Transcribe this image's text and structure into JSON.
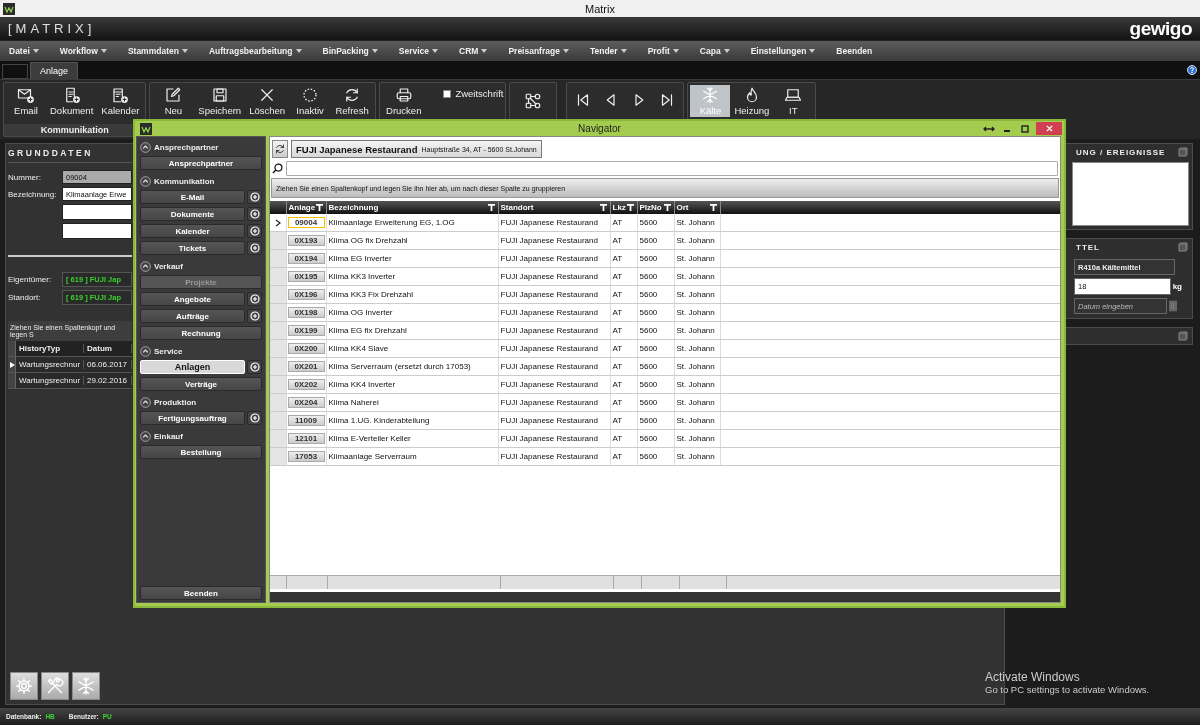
{
  "window": {
    "title": "Matrix"
  },
  "header": {
    "app_name": "[MATRIX]",
    "logo": "gewigo"
  },
  "menu": [
    {
      "label": "Datei",
      "kind": "dropdown"
    },
    {
      "label": "Workflow",
      "kind": "dropdown"
    },
    {
      "label": "Stammdaten",
      "kind": "dropdown"
    },
    {
      "label": "Auftragsbearbeitung",
      "kind": "dropdown"
    },
    {
      "label": "BinPacking",
      "kind": "dropdown"
    },
    {
      "label": "Service",
      "kind": "dropdown"
    },
    {
      "label": "CRM",
      "kind": "dropdown"
    },
    {
      "label": "Preisanfrage",
      "kind": "dropdown"
    },
    {
      "label": "Tender",
      "kind": "dropdown"
    },
    {
      "label": "Profit",
      "kind": "dropdown"
    },
    {
      "label": "Capa",
      "kind": "dropdown"
    },
    {
      "label": "Einstellungen",
      "kind": "dropdown"
    },
    {
      "label": "Beenden",
      "kind": "action"
    }
  ],
  "tabs": [
    {
      "label": "Anlage",
      "selected": true
    }
  ],
  "ribbon": {
    "groups": [
      {
        "label": "Kommunikation",
        "buttons": [
          {
            "kind": "email",
            "label": "Email"
          },
          {
            "kind": "document",
            "label": "Dokument"
          },
          {
            "kind": "calendar",
            "label": "Kalender"
          }
        ]
      },
      {
        "buttons": [
          {
            "kind": "new",
            "label": "Neu"
          },
          {
            "kind": "save",
            "label": "Speichern"
          },
          {
            "kind": "delete",
            "label": "Löschen"
          },
          {
            "kind": "inactive",
            "label": "Inaktiv"
          },
          {
            "kind": "refresh",
            "label": "Refresh"
          }
        ]
      },
      {
        "buttons": [
          {
            "kind": "print",
            "label": "Drucken"
          },
          {
            "kind": "checkbox",
            "label": "Zweitschrift",
            "checked": false
          }
        ]
      },
      {
        "buttons": [
          {
            "kind": "workflow"
          }
        ]
      },
      {
        "buttons": [
          {
            "kind": "first"
          },
          {
            "kind": "prev"
          },
          {
            "kind": "next"
          },
          {
            "kind": "last"
          }
        ]
      },
      {
        "buttons": [
          {
            "kind": "cold",
            "label": "Kälte",
            "selected": true
          },
          {
            "kind": "heat",
            "label": "Heizung",
            "selected": false
          },
          {
            "kind": "it",
            "label": "IT",
            "selected": false
          }
        ]
      }
    ]
  },
  "grunddaten": {
    "title": "GRUNDDATEN",
    "fields": [
      {
        "label": "Nummer:",
        "value": "09004"
      },
      {
        "label": "Bezeichnung:",
        "value": "Klimaanlage Erwe"
      }
    ],
    "links": [
      {
        "label": "Eigentümer:",
        "value": "[ 619 ] FUJI Jap"
      },
      {
        "label": "Standort:",
        "value": "[ 619 ] FUJI Jap"
      }
    ]
  },
  "history": {
    "group_hint": "Ziehen Sie einen Spaltenkopf und legen S",
    "columns": [
      "HistoryTyp",
      "Datum"
    ],
    "rows": [
      {
        "cells": [
          "Wartungsrechnur",
          "06.06.2017"
        ],
        "selected": true
      },
      {
        "cells": [
          "Wartungsrechnur",
          "29.02.2016"
        ],
        "selected": false
      }
    ]
  },
  "bottom_buttons": [
    {
      "kind": "gear"
    },
    {
      "kind": "tools"
    },
    {
      "kind": "cold"
    }
  ],
  "right_panels": [
    {
      "kind": "notes",
      "title": "UNG / EREIGNISSE"
    },
    {
      "kind": "refrigerant",
      "title": "TTEL",
      "refrigerant": "R410a Kältemittel",
      "amount": "18",
      "unit": "kg",
      "date_placeholder": "Datum eingeben"
    },
    {
      "kind": "empty"
    }
  ],
  "navigator": {
    "title": "Navigator",
    "sections": [
      {
        "title": "Ansprechpartner",
        "expanded": true,
        "items": [
          {
            "label": "Ansprechpartner",
            "add": false,
            "disabled": false,
            "selected": false
          }
        ]
      },
      {
        "title": "Kommunikation",
        "expanded": true,
        "items": [
          {
            "label": "E-Mail",
            "add": true,
            "disabled": false,
            "selected": false
          },
          {
            "label": "Dokumente",
            "add": true,
            "disabled": false,
            "selected": false
          },
          {
            "label": "Kalender",
            "add": true,
            "disabled": false,
            "selected": false
          },
          {
            "label": "Tickets",
            "add": true,
            "disabled": false,
            "selected": false
          }
        ]
      },
      {
        "title": "Verkauf",
        "expanded": true,
        "items": [
          {
            "label": "Projekte",
            "add": false,
            "disabled": true,
            "selected": false
          },
          {
            "label": "Angebote",
            "add": true,
            "disabled": false,
            "selected": false
          },
          {
            "label": "Aufträge",
            "add": true,
            "disabled": false,
            "selected": false
          },
          {
            "label": "Rechnung",
            "add": false,
            "disabled": false,
            "selected": false
          }
        ]
      },
      {
        "title": "Service",
        "expanded": true,
        "items": [
          {
            "label": "Anlagen",
            "add": true,
            "disabled": false,
            "selected": true
          },
          {
            "label": "Verträge",
            "add": false,
            "disabled": false,
            "selected": false
          }
        ]
      },
      {
        "title": "Produktion",
        "expanded": true,
        "items": [
          {
            "label": "Fertigungsauftrag",
            "add": true,
            "disabled": false,
            "selected": false
          }
        ]
      },
      {
        "title": "Einkauf",
        "expanded": true,
        "items": [
          {
            "label": "Bestellung",
            "add": false,
            "disabled": false,
            "selected": false
          }
        ]
      }
    ],
    "exit": "Beenden",
    "customer": {
      "name": "FUJI Japanese Restaurand",
      "address": "Hauptstraße 34, AT - 5600 St.Johann"
    },
    "group_hint": "Ziehen Sie einen Spaltenkopf und legen Sie ihn hier ab, um nach dieser Spalte zu gruppieren",
    "columns": [
      "Anlage",
      "Bezeichnung",
      "Standort",
      "Lkz",
      "PlzNo",
      "Ort"
    ],
    "rows": [
      {
        "cells": [
          "09004",
          "Klimaanlage Erweiterung EG, 1.OG",
          "FUJI Japanese Restaurand",
          "AT",
          "5600",
          "St. Johann"
        ],
        "selected": true
      },
      {
        "cells": [
          "0X193",
          "Klima OG fix Drehzahl",
          "FUJI Japanese Restaurand",
          "AT",
          "5600",
          "St. Johann"
        ],
        "selected": false
      },
      {
        "cells": [
          "0X194",
          "Klima EG Inverter",
          "FUJI Japanese Restaurand",
          "AT",
          "5600",
          "St. Johann"
        ],
        "selected": false
      },
      {
        "cells": [
          "0X195",
          "Klima KK3 Inverter",
          "FUJI Japanese Restaurand",
          "AT",
          "5600",
          "St. Johann"
        ],
        "selected": false
      },
      {
        "cells": [
          "0X196",
          "Klima KK3 Fix Drehzahl",
          "FUJI Japanese Restaurand",
          "AT",
          "5600",
          "St. Johann"
        ],
        "selected": false
      },
      {
        "cells": [
          "0X198",
          "Klima OG Inverter",
          "FUJI Japanese Restaurand",
          "AT",
          "5600",
          "St. Johann"
        ],
        "selected": false
      },
      {
        "cells": [
          "0X199",
          "Klima EG fix Drehzahl",
          "FUJI Japanese Restaurand",
          "AT",
          "5600",
          "St. Johann"
        ],
        "selected": false
      },
      {
        "cells": [
          "0X200",
          "Klima KK4 Slave",
          "FUJI Japanese Restaurand",
          "AT",
          "5600",
          "St. Johann"
        ],
        "selected": false
      },
      {
        "cells": [
          "0X201",
          "Klima Serverraum (ersetzt durch 17053)",
          "FUJI Japanese Restaurand",
          "AT",
          "5600",
          "St. Johann"
        ],
        "selected": false
      },
      {
        "cells": [
          "0X202",
          "Klima KK4 Inverter",
          "FUJI Japanese Restaurand",
          "AT",
          "5600",
          "St. Johann"
        ],
        "selected": false
      },
      {
        "cells": [
          "0X204",
          "Klima Naherei",
          "FUJI Japanese Restaurand",
          "AT",
          "5600",
          "St. Johann"
        ],
        "selected": false
      },
      {
        "cells": [
          "11009",
          "Klima 1.UG. Kinderabteilung",
          "FUJI Japanese Restaurand",
          "AT",
          "5600",
          "St. Johann"
        ],
        "selected": false
      },
      {
        "cells": [
          "12101",
          "Klima E-Verteiler Keller",
          "FUJI Japanese Restaurand",
          "AT",
          "5600",
          "St. Johann"
        ],
        "selected": false
      },
      {
        "cells": [
          "17053",
          "Klimaanlage Serverraum",
          "FUJI Japanese Restaurand",
          "AT",
          "5600",
          "St. Johann"
        ],
        "selected": false
      }
    ]
  },
  "status_bar": [
    {
      "label": "Datenbank:",
      "value": "HB"
    },
    {
      "label": "Benutzer:",
      "value": "PU"
    }
  ],
  "os_notice": {
    "title": "Activate Windows",
    "text": "Go to PC settings to activate Windows."
  }
}
